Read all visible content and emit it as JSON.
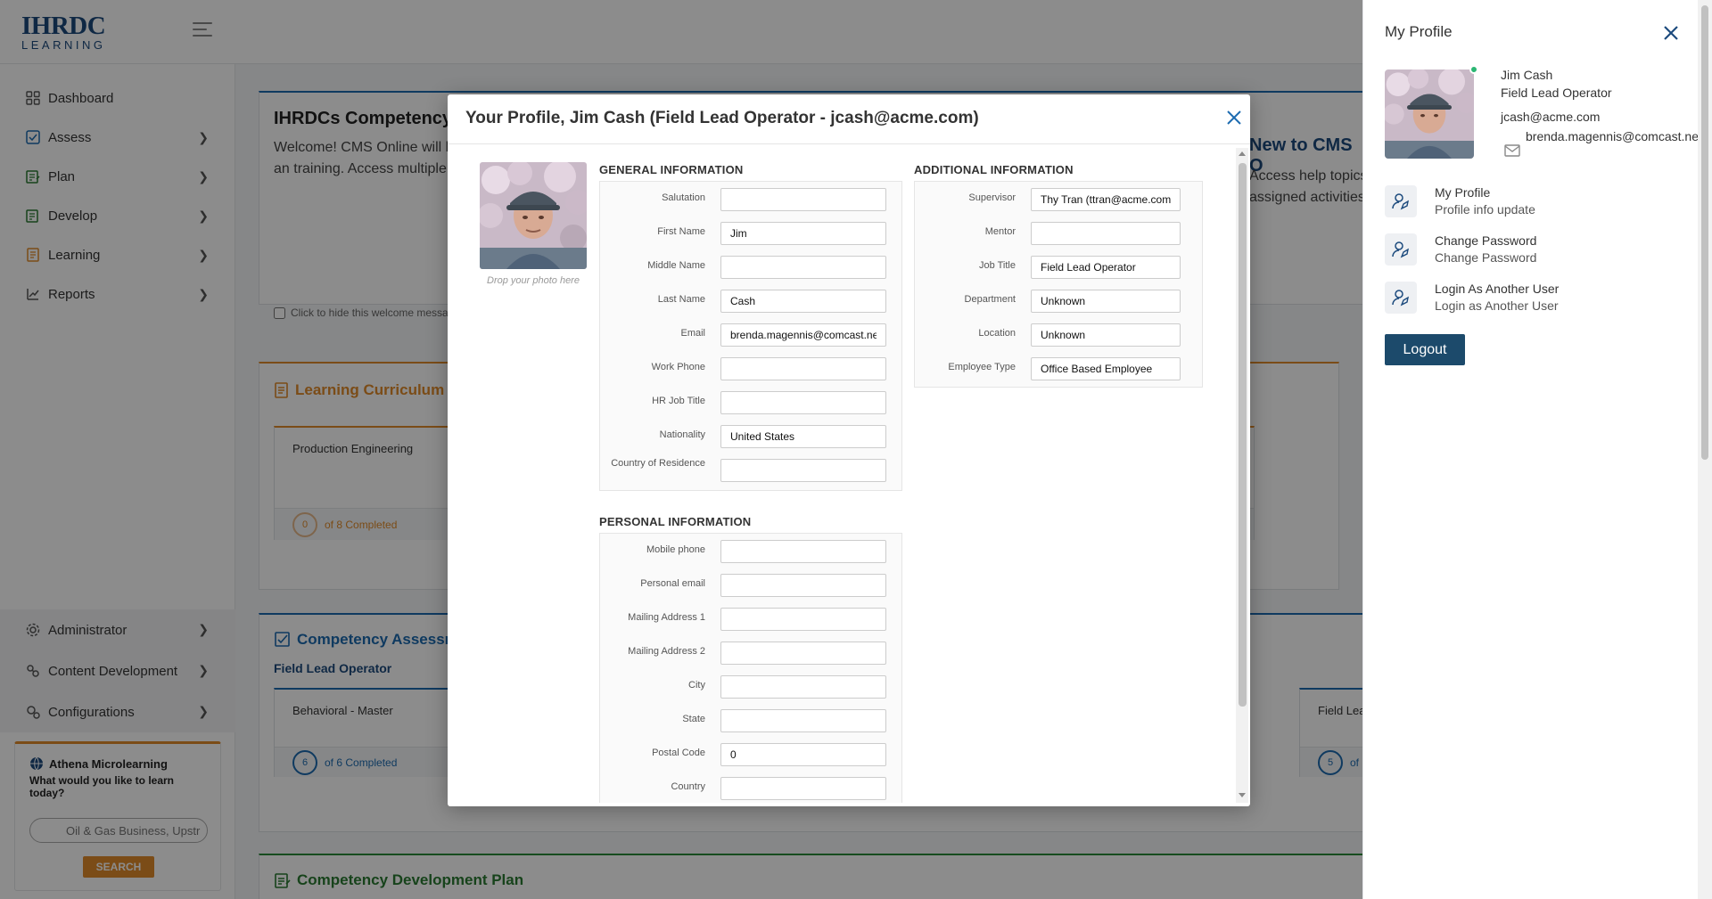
{
  "app": {
    "logo_main": "IHRDC",
    "logo_sub": "LEARNING"
  },
  "sidebar": {
    "items": [
      {
        "label": "Dashboard",
        "icon": "dashboard-grid-icon"
      },
      {
        "label": "Assess",
        "icon": "assess-icon"
      },
      {
        "label": "Plan",
        "icon": "plan-icon"
      },
      {
        "label": "Develop",
        "icon": "develop-icon"
      },
      {
        "label": "Learning",
        "icon": "learning-icon"
      },
      {
        "label": "Reports",
        "icon": "reports-icon"
      }
    ],
    "lower_items": [
      {
        "label": "Administrator",
        "icon": "gear-icon"
      },
      {
        "label": "Content Development",
        "icon": "content-dev-icon"
      },
      {
        "label": "Configurations",
        "icon": "configurations-icon"
      }
    ]
  },
  "athena": {
    "title": "Athena Microlearning",
    "question": "What would you like to learn today?",
    "search_placeholder": "Oil & Gas Business, Upstr",
    "search_button": "SEARCH"
  },
  "dashboard": {
    "welcome_title": "IHRDCs Competency",
    "welcome_text": "Welcome! CMS Online will h competency status, build an training. Access multiple rep",
    "hide_welcome": "Click to hide this welcome messa",
    "new_title": "New to CMS O",
    "new_text": "Access help topics assigned activities",
    "curriculum_title": "Learning Curriculum",
    "curriculum_item": "Production Engineering",
    "curriculum_count": "0",
    "curriculum_progress": "of 8 Completed",
    "assess_title": "Competency Assessm",
    "assess_role": "Field Lead Operator",
    "assess_item": "Behavioral - Master",
    "assess_count": "6",
    "assess_progress": "of 6 Completed",
    "assess_item2": "Field Lea",
    "assess_count2": "5",
    "assess_progress2": "of",
    "dev_title": "Competency Development Plan"
  },
  "modal": {
    "title": "Your Profile, Jim Cash (Field Lead Operator - jcash@acme.com)",
    "drop_hint": "Drop your photo here",
    "general_title": "GENERAL INFORMATION",
    "general_fields": [
      {
        "label": "Salutation",
        "value": ""
      },
      {
        "label": "First Name",
        "value": "Jim"
      },
      {
        "label": "Middle Name",
        "value": ""
      },
      {
        "label": "Last Name",
        "value": "Cash"
      },
      {
        "label": "Email",
        "value": "brenda.magennis@comcast.ne"
      },
      {
        "label": "Work Phone",
        "value": ""
      },
      {
        "label": "HR Job Title",
        "value": ""
      },
      {
        "label": "Nationality",
        "value": "United States"
      },
      {
        "label": "Country of Residence",
        "value": ""
      }
    ],
    "additional_title": "ADDITIONAL INFORMATION",
    "additional_fields": [
      {
        "label": "Supervisor",
        "value": "Thy Tran (ttran@acme.com"
      },
      {
        "label": "Mentor",
        "value": ""
      },
      {
        "label": "Job Title",
        "value": "Field Lead Operator"
      },
      {
        "label": "Department",
        "value": "Unknown"
      },
      {
        "label": "Location",
        "value": "Unknown"
      },
      {
        "label": "Employee Type",
        "value": "Office Based Employee"
      }
    ],
    "personal_title": "PERSONAL INFORMATION",
    "personal_fields": [
      {
        "label": "Mobile phone",
        "value": ""
      },
      {
        "label": "Personal email",
        "value": ""
      },
      {
        "label": "Mailing Address 1",
        "value": ""
      },
      {
        "label": "Mailing Address 2",
        "value": ""
      },
      {
        "label": "City",
        "value": ""
      },
      {
        "label": "State",
        "value": ""
      },
      {
        "label": "Postal Code",
        "value": "0"
      },
      {
        "label": "Country",
        "value": ""
      }
    ]
  },
  "drawer": {
    "title": "My Profile",
    "name": "Jim Cash",
    "role": "Field Lead Operator",
    "email": "jcash@acme.com",
    "email2": "brenda.magennis@comcast.net",
    "links": [
      {
        "title": "My Profile",
        "sub": "Profile info update"
      },
      {
        "title": "Change Password",
        "sub": "Change Password"
      },
      {
        "title": "Login As Another User",
        "sub": "Login as Another User"
      }
    ],
    "logout": "Logout"
  },
  "colors": {
    "brand_navy": "#1c4a7d",
    "accent_orange": "#e08a2a",
    "accent_blue": "#1c6bb0",
    "accent_green": "#2a7a32",
    "logout_bg": "#1c4a6b",
    "online_green": "#2bb673"
  }
}
